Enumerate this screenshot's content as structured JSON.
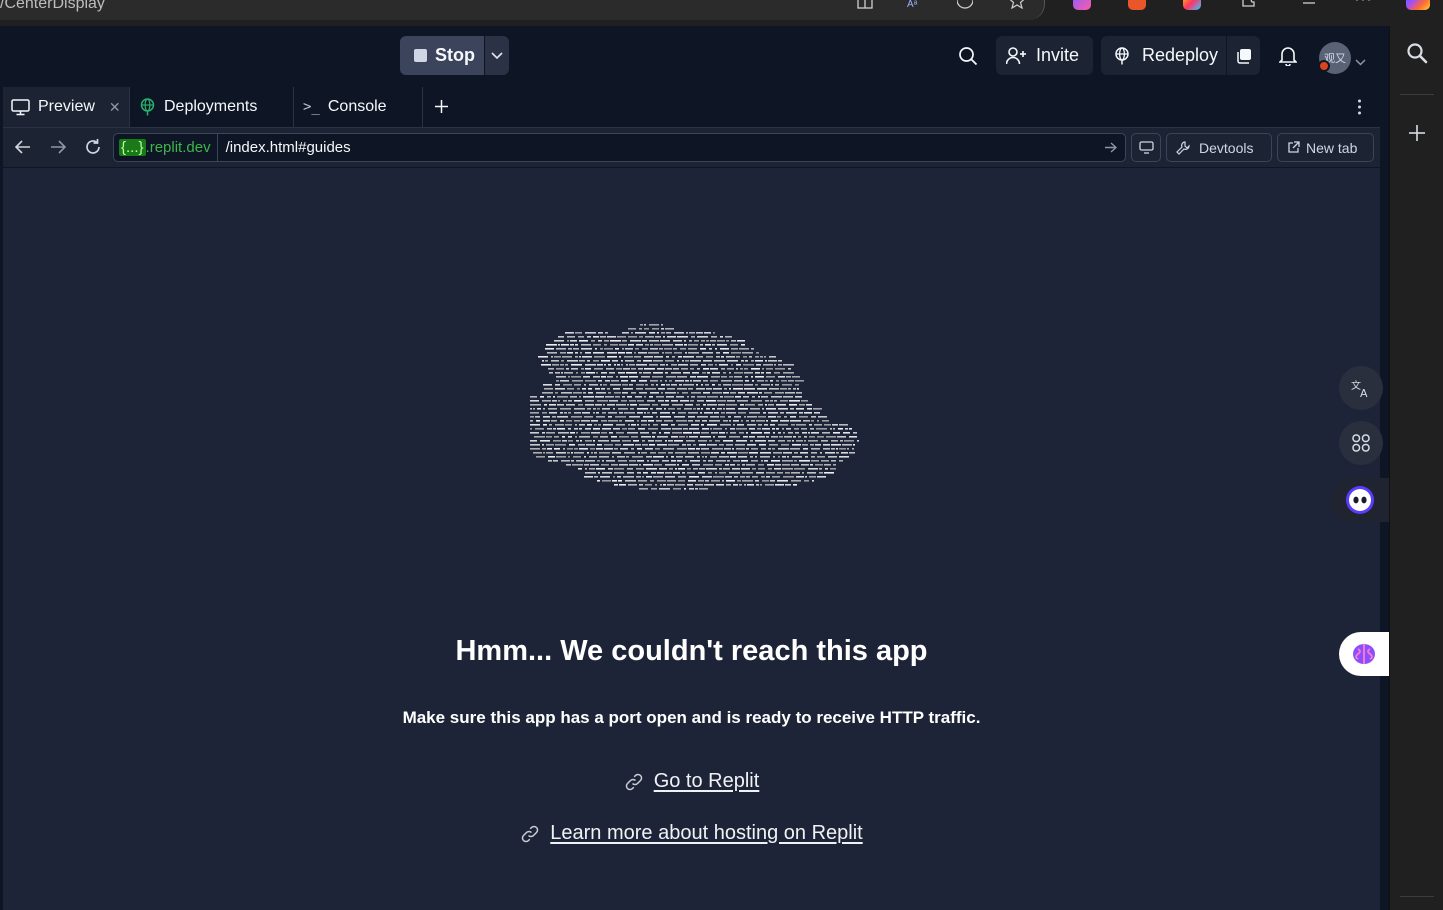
{
  "browser": {
    "url_fragment": "/CenterDisplay"
  },
  "toolbar": {
    "stop_label": "Stop",
    "invite_label": "Invite",
    "redeploy_label": "Redeploy",
    "avatar_text": "观又"
  },
  "tabs": [
    {
      "label": "Preview",
      "active": true
    },
    {
      "label": "Deployments",
      "active": false
    },
    {
      "label": "Console",
      "active": false
    }
  ],
  "addressbar": {
    "host_badge": "{...}",
    "host_domain": ".replit.dev",
    "path": "/index.html#guides",
    "devtools_label": "Devtools",
    "newtab_label": "New tab"
  },
  "preview": {
    "title": "Hmm... We couldn't reach this app",
    "subtitle": "Make sure this app has a port open and is ready to receive HTTP traffic.",
    "link_replit": "Go to Replit",
    "link_hosting": "Learn more about hosting on Replit"
  },
  "colors": {
    "workspace_bg": "#0e1525",
    "preview_bg": "#1e2437",
    "url_domain": "#3db54a",
    "stop_button": "#3c445c"
  }
}
